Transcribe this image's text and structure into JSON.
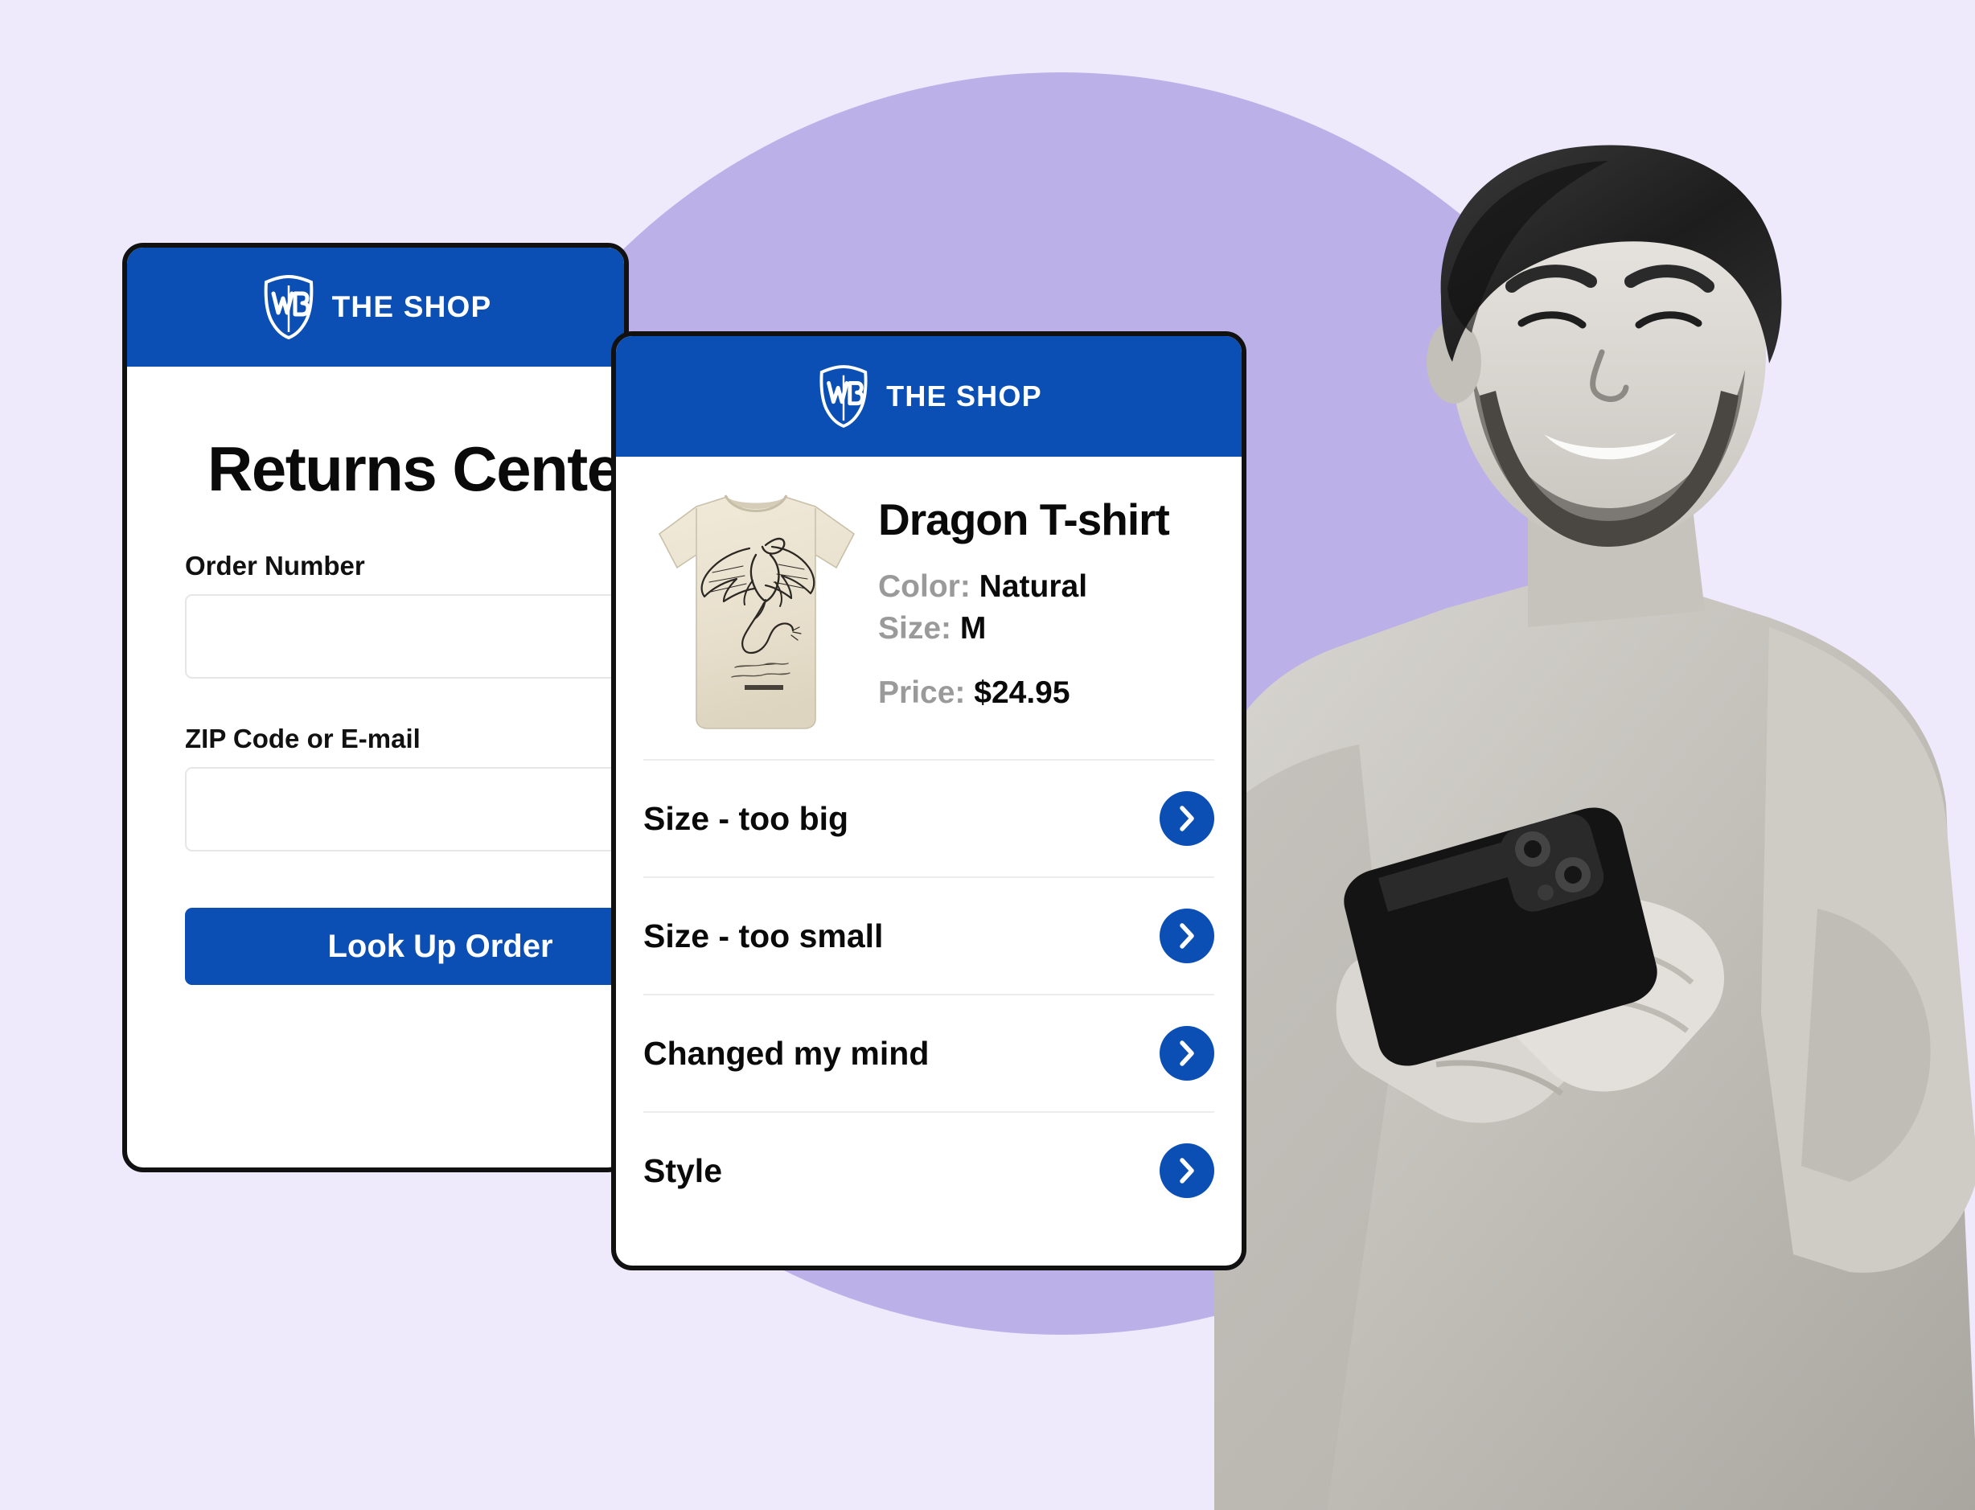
{
  "theme": {
    "page_background": "#EEEAFC",
    "accent_circle": "#BCB0E8",
    "brand_blue": "#0B4FB5",
    "border_black": "#111111",
    "muted_gray": "#9A9A9A"
  },
  "brand": {
    "logo_icon": "wb-shield-icon",
    "name": "THE SHOP"
  },
  "returns_card": {
    "header_brand": "THE SHOP",
    "title": "Returns Center",
    "fields": [
      {
        "label": "Order Number",
        "value": "",
        "placeholder": ""
      },
      {
        "label": "ZIP Code or E-mail",
        "value": "",
        "placeholder": ""
      }
    ],
    "submit_label": "Look Up Order"
  },
  "reasons_card": {
    "header_brand": "THE SHOP",
    "product": {
      "image_alt": "dragon-tshirt-natural",
      "title": "Dragon T-shirt",
      "attributes": [
        {
          "key": "Color:",
          "value": "Natural"
        },
        {
          "key": "Size:",
          "value": "M"
        }
      ],
      "price_key": "Price:",
      "price_value": "$24.95"
    },
    "reasons": [
      {
        "label": "Size - too big",
        "chevron": "chevron-right-icon"
      },
      {
        "label": "Size - too small",
        "chevron": "chevron-right-icon"
      },
      {
        "label": "Changed my mind",
        "chevron": "chevron-right-icon"
      },
      {
        "label": "Style",
        "chevron": "chevron-right-icon"
      }
    ]
  },
  "photo": {
    "alt": "smiling-man-holding-phone"
  }
}
